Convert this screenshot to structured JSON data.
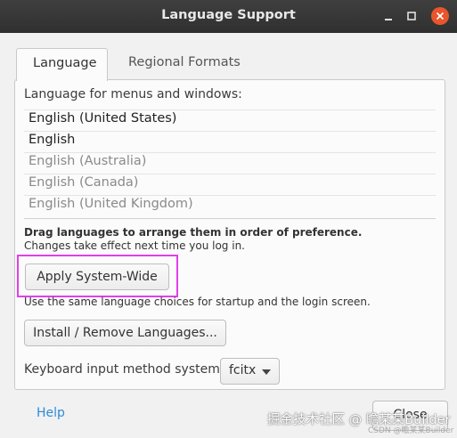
{
  "window": {
    "title": "Language Support"
  },
  "tabs": [
    {
      "label": "Language",
      "active": true
    },
    {
      "label": "Regional Formats",
      "active": false
    }
  ],
  "language_tab": {
    "menus_label": "Language for menus and windows:",
    "languages": [
      {
        "label": "English (United States)",
        "active": true
      },
      {
        "label": "English",
        "active": true
      },
      {
        "label": "English (Australia)",
        "active": false
      },
      {
        "label": "English (Canada)",
        "active": false
      },
      {
        "label": "English (United Kingdom)",
        "active": false
      }
    ],
    "drag_hint": "Drag languages to arrange them in order of preference.",
    "effect_hint": "Changes take effect next time you log in.",
    "apply_button": "Apply System-Wide",
    "apply_hint": "Use the same language choices for startup and the login screen.",
    "install_button": "Install / Remove Languages...",
    "keyboard_label": "Keyboard input method system:",
    "keyboard_value": "fcitx"
  },
  "footer": {
    "help_label": "Help",
    "close_label": "Close"
  },
  "watermark": {
    "text": "掘金技术社区 @ 瞻某某Builder",
    "small_text": "CSDN @瞻某某Builder"
  },
  "colors": {
    "titlebar": "#303030",
    "close_button": "#e9552c",
    "highlight": "#e040e8",
    "help_link": "#2c8ad8"
  }
}
